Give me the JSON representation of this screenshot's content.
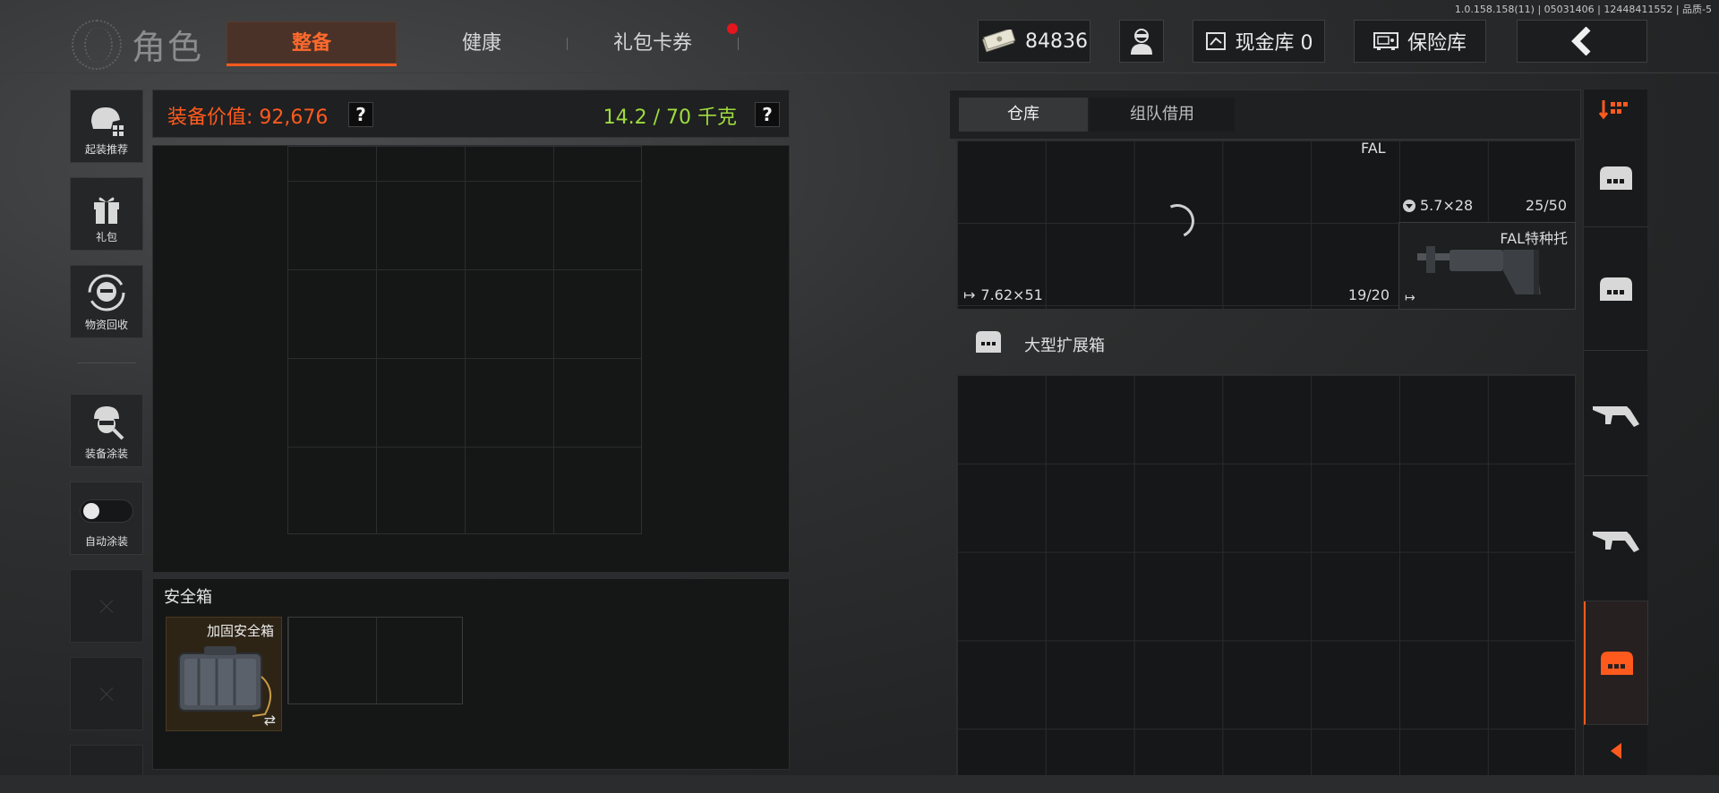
{
  "version": "1.0.158.158(11) | 05031406 | 12448411552 | 品质-5",
  "header": {
    "title": "角色",
    "tabs": [
      {
        "label": "整备",
        "active": true
      },
      {
        "label": "健康",
        "active": false
      },
      {
        "label": "礼包卡券",
        "active": false,
        "badge": true
      }
    ],
    "currency": "84836",
    "cash_vault": "现金库 0",
    "safe_vault": "保险库"
  },
  "sidebar": {
    "items": [
      {
        "label": "起装推荐",
        "icon": "helmet-grid-icon"
      },
      {
        "label": "礼包",
        "icon": "gift-icon"
      },
      {
        "label": "物资回收",
        "icon": "recycle-face-icon"
      },
      {
        "label": "装备涂装",
        "icon": "soldier-paint-icon"
      },
      {
        "label": "自动涂装",
        "icon": "toggle-icon",
        "toggle_on": false
      }
    ]
  },
  "equipment": {
    "value_label": "装备价值: 92,676",
    "help": "?",
    "weight": "14.2 / 70 千克"
  },
  "safebox": {
    "title": "安全箱",
    "item_name": "加固安全箱",
    "swap_glyph": "⇄"
  },
  "storage": {
    "tabs": [
      {
        "label": "仓库",
        "active": true
      },
      {
        "label": "组队借用",
        "active": false
      }
    ],
    "items": {
      "fal_name": "FAL",
      "ammo_1": "7.62×51",
      "ammo_1_count": "19/20",
      "ammo_2": "5.7×28",
      "ammo_2_count": "25/50",
      "stock_name": "FAL特种托"
    },
    "expansion_label": "大型扩展箱"
  },
  "colors": {
    "accent": "#ff5a1e",
    "weight_ok": "#9edc3f",
    "badge": "#e3161d"
  }
}
